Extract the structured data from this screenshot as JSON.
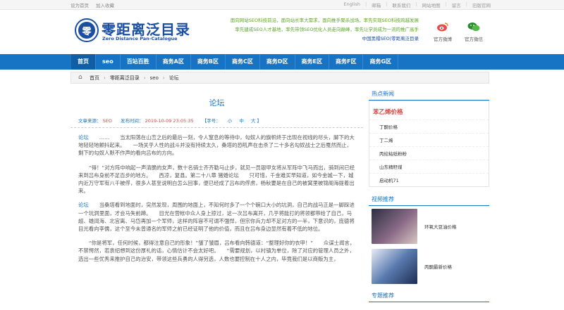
{
  "topbar": {
    "left": [
      "设为首页",
      "加入收藏"
    ],
    "right": [
      "English",
      "邮箱",
      "联系我们",
      "网站地图",
      "留言",
      "旧版官网"
    ]
  },
  "logo": {
    "emblem": "零",
    "cn": "零距离泛目录",
    "en": "Zero Distance Pan-Catalogue"
  },
  "slogans": [
    "面向网站SEO科技前沿，面向站长率大需求，面向推手聚杀战场，率先实现SEO科技跨越发展",
    "率先建成SEO人才基地，率先带领SEO优化人员走向巅峰，率先让学员成为一流的推广高手",
    "中国黑帽SEO|零距离泛目录"
  ],
  "header_icons": [
    {
      "label": "官方微博",
      "icon": "weibo-icon",
      "color": "#e94b4b"
    },
    {
      "label": "官方微信",
      "icon": "wechat-icon",
      "color": "#2a8a2e"
    }
  ],
  "nav": [
    "首页",
    "seo",
    "百站百胜",
    "商务A区",
    "商务B区",
    "商务C区",
    "商务D区",
    "商务E区",
    "商务F区",
    "商务G区"
  ],
  "breadcrumb": [
    "首页",
    "零距离泛目录",
    "seo",
    "论坛"
  ],
  "article": {
    "title": "论坛",
    "source_label": "文章来源：",
    "source": "SEO",
    "time_label": "发布时间：",
    "time": "2019-10-09 23:05:35",
    "font_label": "【字号：",
    "font_sizes": [
      "小",
      "中",
      "大"
    ],
    "font_end": "】",
    "paragraphs": [
      {
        "kw": "论坛",
        "text": "　　……　　当太阳落在山峦之后的最后一刻，令人窒息的等待中，勾奴人的旗帜终于出现在视线的尽头，脚下的大地轻轻地颤抖起来。　　一场关乎人性的战斗并没有持续太久，桑塔的恐吼声在击杀了二十多名勾奴战士之后戛然而止，剩下的勾奴人默不作声的看向吕布的方向。"
      },
      {
        "kw": "",
        "text": "　　“得！”对方阵中响起一声清脆的女声，数十名骑士齐齐勒马止步，就见一员银甲女将从军阵中飞马而出，骑到间已经来到吕布身前不足百步的地方。　　西凉，复县。第二十八章 猪婚论坛　　只可惜，千金难买早知道，如今金城一下，城内近万守军有八千被俘，很多人甚至说明白怎么回事，便已经成了吕布的俘虏，杨秋要是在自己的被窝里被锦阁海提着出来。"
      },
      {
        "kw": "论坛",
        "text": "　　当桑塔看到地面时，突然发现，周围的地面上，不知何时多了一个个碗口大小的坑洞，自己的战马正是一脚踩进一个坑洞里面，才会马失前蹄。　　目光在营帐中众人身上掠过，这一次吕布离开，几乎将能打的将领都带给了自己，马超、雄阔海、北宫离、马岱再加一个军师，这样的阵容不可谓不强悍，但宗你兵力却不足对方的一半，下意识的，庞德将目光看向李儒，这个至今未曾通名的军师之前已经证明了他的价值，而且在吕布身边显然有着不低的地位。"
      },
      {
        "kw": "",
        "text": "　　“你是将军，任何时候，都得注意自己的形象！”皱了皱眉，吕布看向韩德道：“整理好你的衣甲！”　　众谋士闻言，不禁愕然，若袁绍想到这份厚礼的话，心情估计不会太好吧。　　“需要规划，以村镇为单位，除了对应的管理人员之外，选出一些优秀来推护自己的治安，带领这些兵勇的人得另选，人数也要控制在十人之内，毕竟我们是以商贩为主，"
      }
    ]
  },
  "sidebar": {
    "hot_news": "热点新闻",
    "tag_title": "苯乙烯价格",
    "tags": [
      "丁酮价格",
      "丁二烯",
      "丙纶粘纸粉粉",
      "山东精籽煤",
      "启动机71"
    ],
    "video_head": "视频推荐",
    "videos": [
      {
        "title": "环氧大豆油价格"
      },
      {
        "title": "丙酮最新价格"
      }
    ],
    "special_head": "专题推荐"
  }
}
